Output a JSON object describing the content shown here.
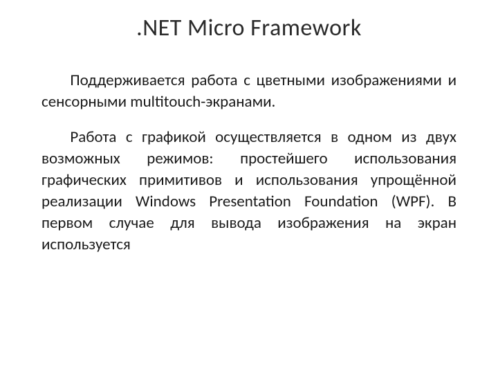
{
  "title": ".NET Micro Framework",
  "paragraphs": [
    "Поддерживается работа с цветными изображениями и сенсорными multitouch-экранами.",
    "Работа с графикой осуществляется в одном из двух возможных режимов: простейшего использования графических примитивов и использования упрощённой реализации Windows Presentation Foundation (WPF). В первом случае для вывода изображения на экран используется"
  ]
}
